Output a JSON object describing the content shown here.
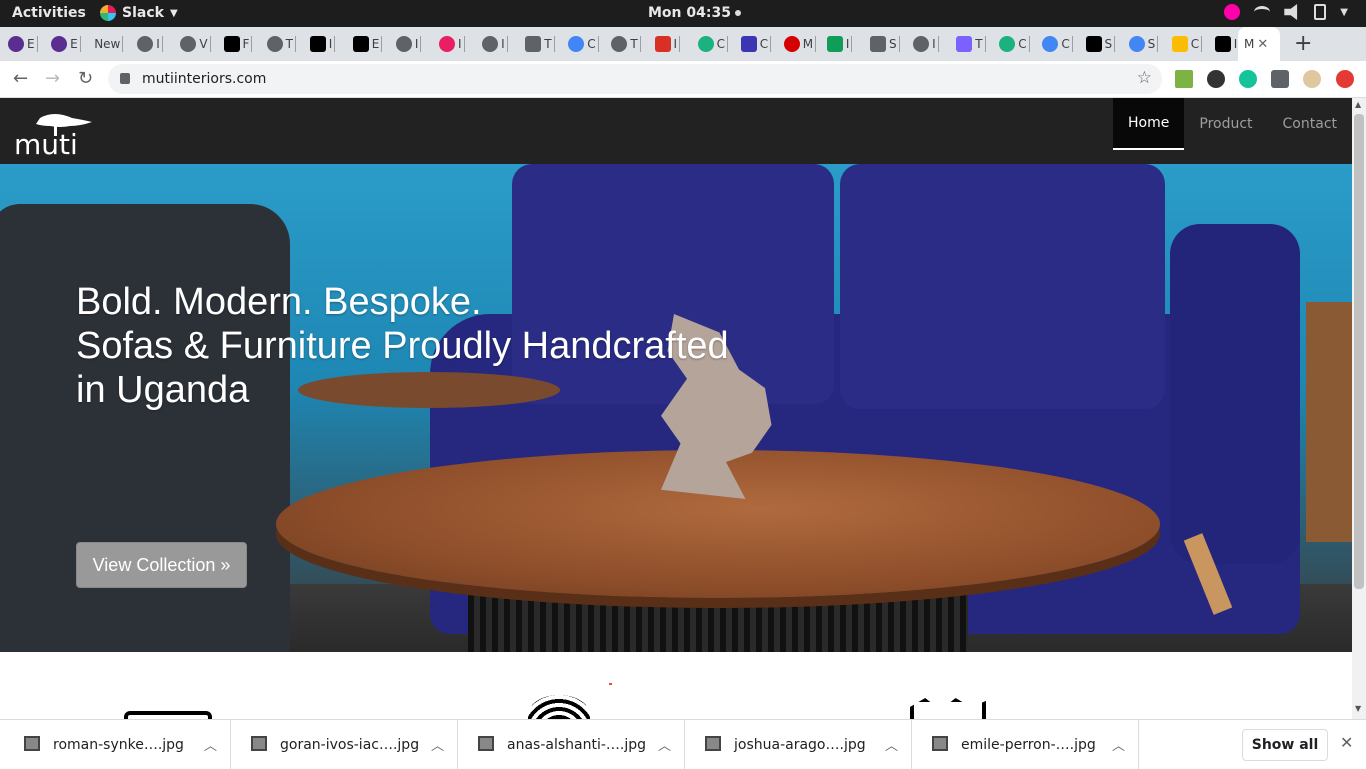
{
  "os_bar": {
    "activities": "Activities",
    "app_name": "Slack",
    "clock": "Mon 04:35"
  },
  "browser": {
    "tabs": [
      {
        "label": "E",
        "icon": "purple-list-icon",
        "color": "#5b2d91"
      },
      {
        "label": "E",
        "icon": "purple-list-icon",
        "color": "#5b2d91"
      },
      {
        "label": "New",
        "icon": "none",
        "color": ""
      },
      {
        "label": "I",
        "icon": "globe-icon",
        "color": "#5f6368"
      },
      {
        "label": "V",
        "icon": "globe-icon",
        "color": "#5f6368"
      },
      {
        "label": "F",
        "icon": "codepen-icon",
        "color": "#000000"
      },
      {
        "label": "T",
        "icon": "globe-icon",
        "color": "#5f6368"
      },
      {
        "label": "I",
        "icon": "github-icon",
        "color": "#000000"
      },
      {
        "label": "E",
        "icon": "black-square-icon",
        "color": "#000000"
      },
      {
        "label": "I",
        "icon": "globe-icon",
        "color": "#5f6368"
      },
      {
        "label": "I",
        "icon": "color-wheel-icon",
        "color": "#e91e63"
      },
      {
        "label": "I",
        "icon": "globe-icon",
        "color": "#5f6368"
      },
      {
        "label": "T",
        "icon": "link-icon",
        "color": "#5f6368"
      },
      {
        "label": "C",
        "icon": "chrome-icon",
        "color": "#4285f4"
      },
      {
        "label": "T",
        "icon": "globe-icon",
        "color": "#5f6368"
      },
      {
        "label": "I",
        "icon": "gmail-icon",
        "color": "#d93025"
      },
      {
        "label": "C",
        "icon": "t-icon",
        "color": "#1bb27f"
      },
      {
        "label": "C",
        "icon": "calendar-icon",
        "color": "#3b34b3"
      },
      {
        "label": "M",
        "icon": "record-icon",
        "color": "#d50000"
      },
      {
        "label": "I",
        "icon": "plus-green-icon",
        "color": "#0f9d58"
      },
      {
        "label": "S",
        "icon": "code-icon",
        "color": "#5f6368"
      },
      {
        "label": "I",
        "icon": "globe-icon",
        "color": "#5f6368"
      },
      {
        "label": "T",
        "icon": "hex-icon",
        "color": "#7b61ff"
      },
      {
        "label": "C",
        "icon": "t-icon",
        "color": "#1bb27f"
      },
      {
        "label": "C",
        "icon": "google-icon",
        "color": "#4285f4"
      },
      {
        "label": "S",
        "icon": "black-square-icon",
        "color": "#000000"
      },
      {
        "label": "S",
        "icon": "google-icon",
        "color": "#4285f4"
      },
      {
        "label": "C",
        "icon": "drive-icon",
        "color": "#fbbc04"
      },
      {
        "label": "I",
        "icon": "medium-icon",
        "color": "#000000"
      }
    ],
    "active_tab": {
      "label": "M",
      "close": "✕"
    },
    "new_tab": "+",
    "url": "mutiinteriors.com"
  },
  "site": {
    "logo_text": "muti",
    "nav": [
      "Home",
      "Product",
      "Contact"
    ],
    "hero": {
      "line1": "Bold. Modern. Bespoke.",
      "line2": "Sofas & Furniture Proudly Handcrafted",
      "line3": "in Uganda",
      "button": "View Collection »"
    }
  },
  "downloads": {
    "items": [
      "roman-synke….jpg",
      "goran-ivos-iac….jpg",
      "anas-alshanti-….jpg",
      "joshua-arago….jpg",
      "emile-perron-….jpg"
    ],
    "show_all": "Show all",
    "close": "✕"
  }
}
